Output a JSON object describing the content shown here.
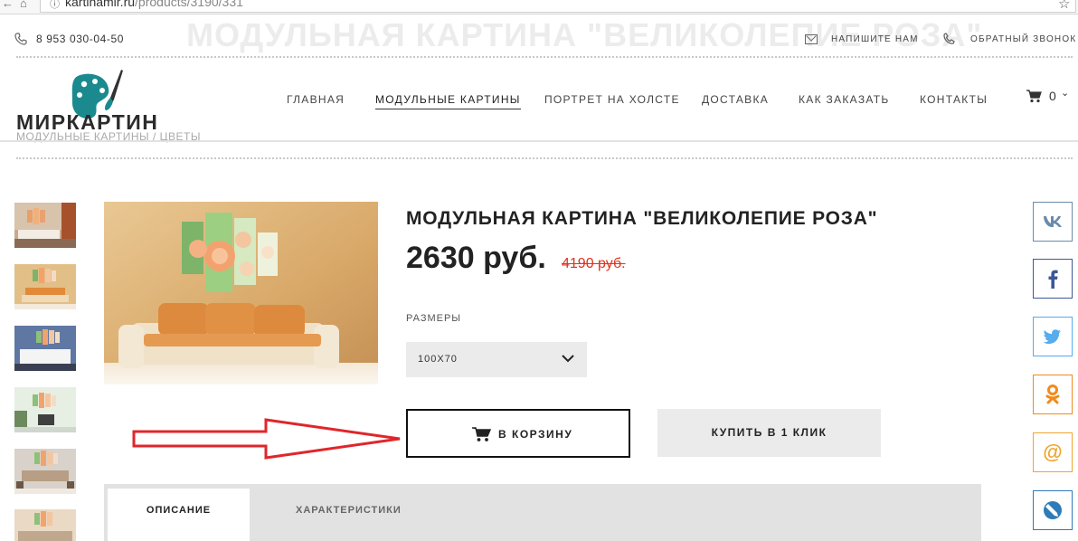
{
  "browser": {
    "url_host": "kartinamir.ru",
    "url_path": "/products/3190/331"
  },
  "background": {
    "ghost_title": "МОДУЛЬНАЯ КАРТИНА \"ВЕЛИКОЛЕПИЕ РОЗА\"",
    "ghost_breadcrumb": "МОДУЛЬНЫЕ КАРТИНЫ  /  ЦВЕТЫ"
  },
  "header": {
    "phone": "8 953 030-04-50",
    "write_us": "НАПИШИТЕ НАМ",
    "callback": "ОБРАТНЫЙ ЗВОНОК",
    "logo_text": "МИРКАРТИН",
    "nav": [
      {
        "label": "ГЛАВНАЯ"
      },
      {
        "label": "МОДУЛЬНЫЕ КАРТИНЫ"
      },
      {
        "label": "ПОРТРЕТ НА ХОЛСТЕ"
      },
      {
        "label": "ДОСТАВКА"
      },
      {
        "label": "КАК ЗАКАЗАТЬ"
      },
      {
        "label": "КОНТАКТЫ"
      }
    ],
    "cart_count": "0"
  },
  "product": {
    "title": "МОДУЛЬНАЯ КАРТИНА \"ВЕЛИКОЛЕПИЕ РОЗА\"",
    "price": "2630 руб.",
    "old_price": "4190 руб.",
    "sizes_label": "РАЗМЕРЫ",
    "size_selected": "100X70",
    "add_to_cart": "В КОРЗИНУ",
    "buy_one_click": "КУПИТЬ В 1 КЛИК"
  },
  "tabs": [
    {
      "label": "ОПИСАНИЕ",
      "active": true
    },
    {
      "label": "ХАРАКТЕРИСТИКИ",
      "active": false
    }
  ],
  "social": [
    {
      "icon": "vk-icon",
      "color": "#6a8bad"
    },
    {
      "icon": "facebook-icon",
      "color": "#3b5998"
    },
    {
      "icon": "twitter-icon",
      "color": "#55acee"
    },
    {
      "icon": "odnoklassniki-icon",
      "color": "#f28a1a"
    },
    {
      "icon": "mailru-icon",
      "color": "#f0a52d"
    },
    {
      "icon": "livejournal-icon",
      "color": "#2d7bb8"
    }
  ],
  "colors": {
    "accent_red": "#e0311f",
    "button_gray": "#ebebeb",
    "logo_teal": "#1b8a8f"
  }
}
